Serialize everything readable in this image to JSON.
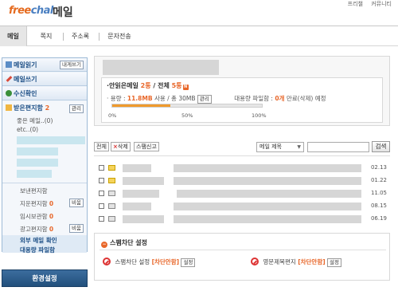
{
  "header": {
    "logo_part1": "free",
    "logo_part2": "chal",
    "title": "메일",
    "top_links": [
      "프리챌",
      "커뮤니티"
    ]
  },
  "tabs": [
    {
      "label": "메일",
      "active": true
    },
    {
      "label": "쪽지",
      "active": false
    },
    {
      "label": "주소록",
      "active": false
    },
    {
      "label": "문자전송",
      "active": false
    }
  ],
  "sidebar": {
    "read_mail": "메일읽기",
    "read_mine_btn": "내게쓰기",
    "write_mail": "메일쓰기",
    "check_receipt": "수신확인",
    "inbox_label": "받은편지함",
    "inbox_count": "2",
    "inbox_manage_btn": "관리",
    "inbox_sub1": "좋은 메일..(0)",
    "inbox_sub2": "etc..(0)",
    "sent": "보낸편지함",
    "trash": "지운편지함",
    "trash_count": "0",
    "trash_empty_btn": "비움",
    "drafts": "임시보관함",
    "drafts_count": "0",
    "ads": "광고편지함",
    "ads_count": "0",
    "ads_empty_btn": "비움",
    "external_mail": "외부 메일 확인",
    "large_file": "대용량 파일함",
    "settings_btn": "환경설정"
  },
  "summary": {
    "unread_label": "·안읽은메일",
    "unread_count": "2통",
    "total_label": "/ 전체",
    "total_count": "5통",
    "usage_label": "· 용량 :",
    "usage_value": "11.8MB",
    "usage_rest": "사용 / 총 30MB",
    "manage_btn": "관리",
    "large_label": "대용량 파일함 :",
    "large_value": "0개",
    "large_rest": "만료(삭제) 예정",
    "progress_fraction": 0.39,
    "pct_0": "0%",
    "pct_50": "50%",
    "pct_100": "100%"
  },
  "toolbar": {
    "all_btn": "전체",
    "delete_btn": "삭제",
    "spam_btn": "스팸신고",
    "delete_mark": "×",
    "select_value": "메일 제목",
    "search_btn": "검색"
  },
  "mails": [
    {
      "date": "02.13",
      "unread": true
    },
    {
      "date": "01.22",
      "unread": true
    },
    {
      "date": "11.05",
      "unread": false
    },
    {
      "date": "08.15",
      "unread": false
    },
    {
      "date": "06.19",
      "unread": false
    }
  ],
  "spam": {
    "title": "스팸차단 설정",
    "item1_label": "스팸차단 설정",
    "item1_value": "[차단안함]",
    "item1_btn": "설정",
    "item2_label": "영문제목편지",
    "item2_value": "[차단안함]",
    "item2_btn": "설정"
  }
}
